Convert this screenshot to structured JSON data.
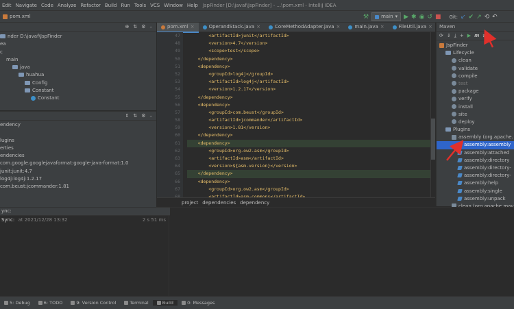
{
  "menu": [
    "Edit",
    "Navigate",
    "Code",
    "Analyze",
    "Refactor",
    "Build",
    "Run",
    "Tools",
    "VCS",
    "Window",
    "Help"
  ],
  "window_title": "JspFinder [D:\\javaf\\JspFinder] - ...\\pom.xml - IntelliJ IDEA",
  "breadcrumb_file": "pom.xml",
  "run_config": "main",
  "git_label": "Git:",
  "project_tree": [
    {
      "label": "nder  D:\\javaf\\JspFinder",
      "indent": 0,
      "type": "folder"
    },
    {
      "label": "ea",
      "indent": 0,
      "type": "text"
    },
    {
      "label": "c",
      "indent": 0,
      "type": "text"
    },
    {
      "label": "main",
      "indent": 1,
      "type": "text"
    },
    {
      "label": "java",
      "indent": 2,
      "type": "folder"
    },
    {
      "label": "huahua",
      "indent": 3,
      "type": "folder"
    },
    {
      "label": "Config",
      "indent": 4,
      "type": "folder"
    },
    {
      "label": "Constant",
      "indent": 4,
      "type": "folder"
    },
    {
      "label": "Constant",
      "indent": 5,
      "type": "class"
    }
  ],
  "dependencies_tree": [
    {
      "label": "endency",
      "indent": 0
    },
    {
      "label": "",
      "indent": 0
    },
    {
      "label": "lugins",
      "indent": 0
    },
    {
      "label": "erties",
      "indent": 0
    },
    {
      "label": "endencies",
      "indent": 0
    },
    {
      "label": "com.google.googlejavaformat:google-java-format:1.0",
      "indent": 0
    },
    {
      "label": "junit:junit:4.7",
      "indent": 0
    },
    {
      "label": "log4j:log4j:1.2.17",
      "indent": 0
    },
    {
      "label": "com.beust:jcommander:1.81",
      "indent": 0
    }
  ],
  "sync": {
    "title": "Sync:",
    "text": "at 2021/12/28 13:32",
    "duration": "2 s 51 ms",
    "tab": "ync:"
  },
  "editor_tabs": [
    {
      "label": "pom.xml",
      "active": true
    },
    {
      "label": "OperandStack.java",
      "active": false
    },
    {
      "label": "CoreMethodAdapter.java",
      "active": false
    },
    {
      "label": "main.java",
      "active": false
    },
    {
      "label": "FileUtil.java",
      "active": false
    }
  ],
  "code_lines": [
    {
      "n": "47",
      "tag": "<artifactId>junit</artifactId>",
      "ind": "        ",
      "hl": false
    },
    {
      "n": "48",
      "tag": "<version>4.7</version>",
      "ind": "        ",
      "hl": false
    },
    {
      "n": "49",
      "tag": "<scope>test</scope>",
      "ind": "        ",
      "hl": false
    },
    {
      "n": "50",
      "tag": "</dependency>",
      "ind": "    ",
      "hl": false
    },
    {
      "n": "51",
      "tag": "<dependency>",
      "ind": "    ",
      "hl": false
    },
    {
      "n": "52",
      "tag": "<groupId>log4j</groupId>",
      "ind": "        ",
      "hl": false
    },
    {
      "n": "53",
      "tag": "<artifactId>log4j</artifactId>",
      "ind": "        ",
      "hl": false
    },
    {
      "n": "54",
      "tag": "<version>1.2.17</version>",
      "ind": "        ",
      "hl": false
    },
    {
      "n": "55",
      "tag": "</dependency>",
      "ind": "    ",
      "hl": false
    },
    {
      "n": "56",
      "tag": "<dependency>",
      "ind": "    ",
      "hl": false
    },
    {
      "n": "57",
      "tag": "<groupId>com.beust</groupId>",
      "ind": "        ",
      "hl": false
    },
    {
      "n": "58",
      "tag": "<artifactId>jcommander</artifactId>",
      "ind": "        ",
      "hl": false
    },
    {
      "n": "59",
      "tag": "<version>1.81</version>",
      "ind": "        ",
      "hl": false
    },
    {
      "n": "60",
      "tag": "</dependency>",
      "ind": "    ",
      "hl": false
    },
    {
      "n": "61",
      "tag": "<dependency>",
      "ind": "    ",
      "hl": true
    },
    {
      "n": "62",
      "tag": "<groupId>org.ow2.asm</groupId>",
      "ind": "        ",
      "hl": false
    },
    {
      "n": "63",
      "tag": "<artifactId>asm</artifactId>",
      "ind": "        ",
      "hl": false
    },
    {
      "n": "64",
      "tag": "<version>${asm.version}</version>",
      "ind": "        ",
      "hl": false
    },
    {
      "n": "65",
      "tag": "</dependency>",
      "ind": "    ",
      "hl": true
    },
    {
      "n": "66",
      "tag": "<dependency>",
      "ind": "    ",
      "hl": false
    },
    {
      "n": "67",
      "tag": "<groupId>org.ow2.asm</groupId>",
      "ind": "        ",
      "hl": false
    },
    {
      "n": "68",
      "tag": "<artifactId>asm-commons</artifactId>",
      "ind": "        ",
      "hl": false
    }
  ],
  "editor_breadcrumb": [
    "project",
    "dependencies",
    "dependency"
  ],
  "maven": {
    "title": "Maven",
    "tree": [
      {
        "label": "JspFinder",
        "indent": 0,
        "kind": "project"
      },
      {
        "label": "Lifecycle",
        "indent": 1,
        "kind": "folder"
      },
      {
        "label": "clean",
        "indent": 2,
        "kind": "gear"
      },
      {
        "label": "validate",
        "indent": 2,
        "kind": "gear"
      },
      {
        "label": "compile",
        "indent": 2,
        "kind": "gear"
      },
      {
        "label": "test",
        "indent": 2,
        "kind": "gear-dim"
      },
      {
        "label": "package",
        "indent": 2,
        "kind": "gear"
      },
      {
        "label": "verify",
        "indent": 2,
        "kind": "gear"
      },
      {
        "label": "install",
        "indent": 2,
        "kind": "gear"
      },
      {
        "label": "site",
        "indent": 2,
        "kind": "gear"
      },
      {
        "label": "deploy",
        "indent": 2,
        "kind": "gear"
      },
      {
        "label": "Plugins",
        "indent": 1,
        "kind": "folder"
      },
      {
        "label": "assembly (org.apache.",
        "indent": 2,
        "kind": "plugin"
      },
      {
        "label": "assembly:assembly",
        "indent": 3,
        "kind": "goal-selected"
      },
      {
        "label": "assembly:attached",
        "indent": 3,
        "kind": "goal"
      },
      {
        "label": "assembly:directory",
        "indent": 3,
        "kind": "goal"
      },
      {
        "label": "assembly:directory-",
        "indent": 3,
        "kind": "goal"
      },
      {
        "label": "assembly:directory-",
        "indent": 3,
        "kind": "goal"
      },
      {
        "label": "assembly:help",
        "indent": 3,
        "kind": "goal"
      },
      {
        "label": "assembly:single",
        "indent": 3,
        "kind": "goal"
      },
      {
        "label": "assembly:unpack",
        "indent": 3,
        "kind": "goal"
      },
      {
        "label": "clean (org.apache.mav",
        "indent": 2,
        "kind": "plugin"
      }
    ]
  },
  "bottom_tabs": [
    {
      "label": "5: Debug",
      "icon": "debug-icon"
    },
    {
      "label": "6: TODO",
      "icon": "todo-icon"
    },
    {
      "label": "9: Version Control",
      "icon": "vcs-icon"
    },
    {
      "label": "Terminal",
      "icon": "terminal-icon"
    },
    {
      "label": "Build",
      "icon": "build-icon",
      "active": true
    },
    {
      "label": "0: Messages",
      "icon": "messages-icon"
    }
  ],
  "colors": {
    "accent": "#4a88c7",
    "selection": "#2f65ca",
    "arrow": "#e0302b",
    "run": "#59a869"
  }
}
